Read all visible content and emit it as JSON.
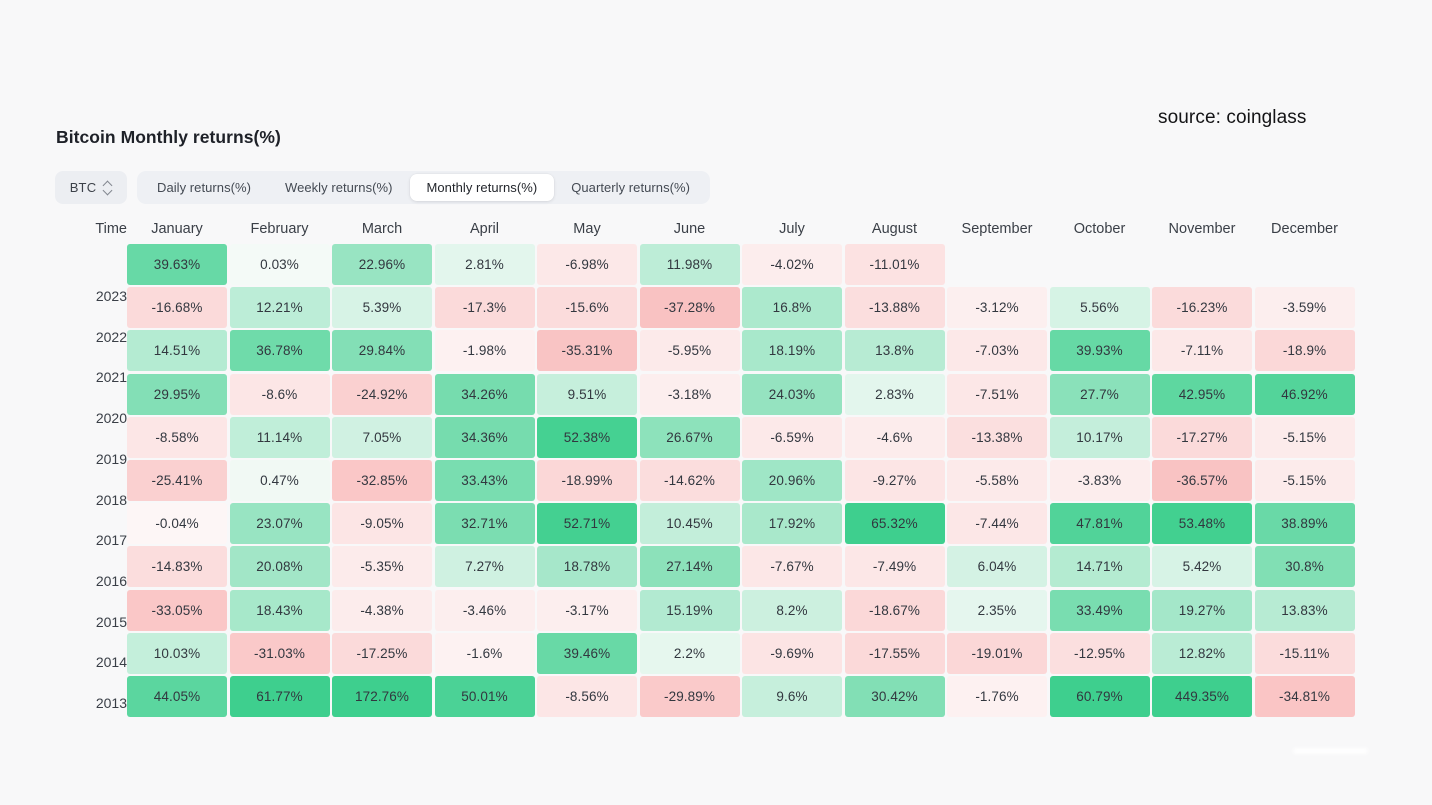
{
  "source_credit": "source: coinglass",
  "title": "Bitcoin Monthly returns(%)",
  "controls": {
    "symbol": "BTC",
    "symbol_icon": "up-down-chevron-icon",
    "tabs": [
      {
        "label": "Daily returns(%)",
        "active": false
      },
      {
        "label": "Weekly returns(%)",
        "active": false
      },
      {
        "label": "Monthly returns(%)",
        "active": true
      },
      {
        "label": "Quarterly returns(%)",
        "active": false
      }
    ]
  },
  "colors": {
    "background": "#f8f8f9",
    "positive_max": "#3ecf8e",
    "positive_min": "#f1faf5",
    "negative_max": "#f8b0b0",
    "negative_min": "#fdf3f3",
    "neutral": "#fafafa",
    "tab_active_bg": "#ffffff",
    "tab_bar_bg": "#eef0f4"
  },
  "chart_data": {
    "type": "heatmap",
    "title": "Bitcoin Monthly returns(%)",
    "row_header": "Time",
    "categories": [
      "January",
      "February",
      "March",
      "April",
      "May",
      "June",
      "July",
      "August",
      "September",
      "October",
      "November",
      "December"
    ],
    "rows": [
      "2023",
      "2022",
      "2021",
      "2020",
      "2019",
      "2018",
      "2017",
      "2016",
      "2015",
      "2014",
      "2013"
    ],
    "unit": "%",
    "values": [
      [
        39.63,
        0.03,
        22.96,
        2.81,
        -6.98,
        11.98,
        -4.02,
        -11.01,
        null,
        null,
        null,
        null
      ],
      [
        -16.68,
        12.21,
        5.39,
        -17.3,
        -15.6,
        -37.28,
        16.8,
        -13.88,
        -3.12,
        5.56,
        -16.23,
        -3.59
      ],
      [
        14.51,
        36.78,
        29.84,
        -1.98,
        -35.31,
        -5.95,
        18.19,
        13.8,
        -7.03,
        39.93,
        -7.11,
        -18.9
      ],
      [
        29.95,
        -8.6,
        -24.92,
        34.26,
        9.51,
        -3.18,
        24.03,
        2.83,
        -7.51,
        27.7,
        42.95,
        46.92
      ],
      [
        -8.58,
        11.14,
        7.05,
        34.36,
        52.38,
        26.67,
        -6.59,
        -4.6,
        -13.38,
        10.17,
        -17.27,
        -5.15
      ],
      [
        -25.41,
        0.47,
        -32.85,
        33.43,
        -18.99,
        -14.62,
        20.96,
        -9.27,
        -5.58,
        -3.83,
        -36.57,
        -5.15
      ],
      [
        -0.04,
        23.07,
        -9.05,
        32.71,
        52.71,
        10.45,
        17.92,
        65.32,
        -7.44,
        47.81,
        53.48,
        38.89
      ],
      [
        -14.83,
        20.08,
        -5.35,
        7.27,
        18.78,
        27.14,
        -7.67,
        -7.49,
        6.04,
        14.71,
        5.42,
        30.8
      ],
      [
        -33.05,
        18.43,
        -4.38,
        -3.46,
        -3.17,
        15.19,
        8.2,
        -18.67,
        2.35,
        33.49,
        19.27,
        13.83
      ],
      [
        10.03,
        -31.03,
        -17.25,
        -1.6,
        39.46,
        2.2,
        -9.69,
        -17.55,
        -19.01,
        -12.95,
        12.82,
        -15.11
      ],
      [
        44.05,
        61.77,
        172.76,
        50.01,
        -8.56,
        -29.89,
        9.6,
        30.42,
        -1.76,
        60.79,
        449.35,
        -34.81
      ]
    ],
    "labels": [
      [
        "39.63%",
        "0.03%",
        "22.96%",
        "2.81%",
        "-6.98%",
        "11.98%",
        "-4.02%",
        "-11.01%",
        "",
        "",
        "",
        ""
      ],
      [
        "-16.68%",
        "12.21%",
        "5.39%",
        "-17.3%",
        "-15.6%",
        "-37.28%",
        "16.8%",
        "-13.88%",
        "-3.12%",
        "5.56%",
        "-16.23%",
        "-3.59%"
      ],
      [
        "14.51%",
        "36.78%",
        "29.84%",
        "-1.98%",
        "-35.31%",
        "-5.95%",
        "18.19%",
        "13.8%",
        "-7.03%",
        "39.93%",
        "-7.11%",
        "-18.9%"
      ],
      [
        "29.95%",
        "-8.6%",
        "-24.92%",
        "34.26%",
        "9.51%",
        "-3.18%",
        "24.03%",
        "2.83%",
        "-7.51%",
        "27.7%",
        "42.95%",
        "46.92%"
      ],
      [
        "-8.58%",
        "11.14%",
        "7.05%",
        "34.36%",
        "52.38%",
        "26.67%",
        "-6.59%",
        "-4.6%",
        "-13.38%",
        "10.17%",
        "-17.27%",
        "-5.15%"
      ],
      [
        "-25.41%",
        "0.47%",
        "-32.85%",
        "33.43%",
        "-18.99%",
        "-14.62%",
        "20.96%",
        "-9.27%",
        "-5.58%",
        "-3.83%",
        "-36.57%",
        "-5.15%"
      ],
      [
        "-0.04%",
        "23.07%",
        "-9.05%",
        "32.71%",
        "52.71%",
        "10.45%",
        "17.92%",
        "65.32%",
        "-7.44%",
        "47.81%",
        "53.48%",
        "38.89%"
      ],
      [
        "-14.83%",
        "20.08%",
        "-5.35%",
        "7.27%",
        "18.78%",
        "27.14%",
        "-7.67%",
        "-7.49%",
        "6.04%",
        "14.71%",
        "5.42%",
        "30.8%"
      ],
      [
        "-33.05%",
        "18.43%",
        "-4.38%",
        "-3.46%",
        "-3.17%",
        "15.19%",
        "8.2%",
        "-18.67%",
        "2.35%",
        "33.49%",
        "19.27%",
        "13.83%"
      ],
      [
        "10.03%",
        "-31.03%",
        "-17.25%",
        "-1.6%",
        "39.46%",
        "2.2%",
        "-9.69%",
        "-17.55%",
        "-19.01%",
        "-12.95%",
        "12.82%",
        "-15.11%"
      ],
      [
        "44.05%",
        "61.77%",
        "172.76%",
        "50.01%",
        "-8.56%",
        "-29.89%",
        "9.6%",
        "30.42%",
        "-1.76%",
        "60.79%",
        "449.35%",
        "-34.81%"
      ]
    ]
  }
}
